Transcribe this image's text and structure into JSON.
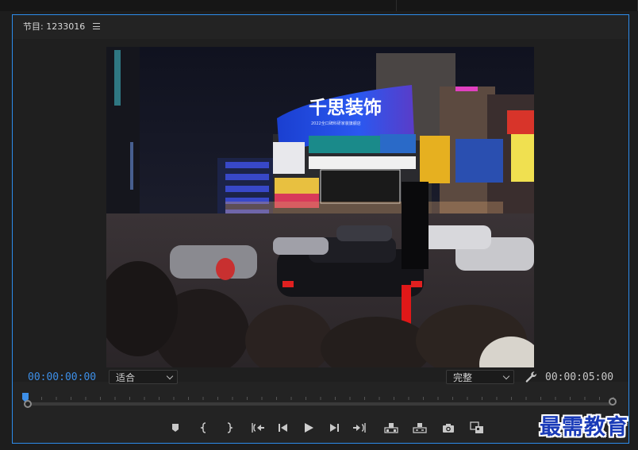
{
  "panel": {
    "title": "节目: 1233016",
    "menu_icon": "hamburger-menu-icon"
  },
  "video": {
    "signs": {
      "main_brand": "千思装饰",
      "main_sub": "2022全口碑科研家装旗舰店"
    }
  },
  "controls": {
    "current_timecode": "00:00:00:00",
    "duration_timecode": "00:00:05:00",
    "zoom_select": "适合",
    "quality_select": "完整",
    "settings_icon": "wrench-icon"
  },
  "timeline": {
    "playhead_position": 0
  },
  "transport": {
    "buttons": [
      {
        "name": "add-marker-button",
        "icon": "marker-icon"
      },
      {
        "name": "mark-in-button",
        "icon": "mark-in-icon"
      },
      {
        "name": "mark-out-button",
        "icon": "mark-out-icon"
      },
      {
        "name": "go-to-in-button",
        "icon": "go-to-in-icon"
      },
      {
        "name": "step-back-button",
        "icon": "step-back-icon"
      },
      {
        "name": "play-button",
        "icon": "play-icon"
      },
      {
        "name": "step-forward-button",
        "icon": "step-forward-icon"
      },
      {
        "name": "go-to-out-button",
        "icon": "go-to-out-icon"
      },
      {
        "name": "lift-button",
        "icon": "lift-icon"
      },
      {
        "name": "extract-button",
        "icon": "extract-icon"
      },
      {
        "name": "export-frame-button",
        "icon": "camera-icon"
      },
      {
        "name": "comparison-view-button",
        "icon": "comparison-icon"
      }
    ]
  },
  "watermark": "最需教育",
  "colors": {
    "accent": "#2d8ceb",
    "timecode_current": "#3d8fe8",
    "panel_bg": "#232323"
  }
}
